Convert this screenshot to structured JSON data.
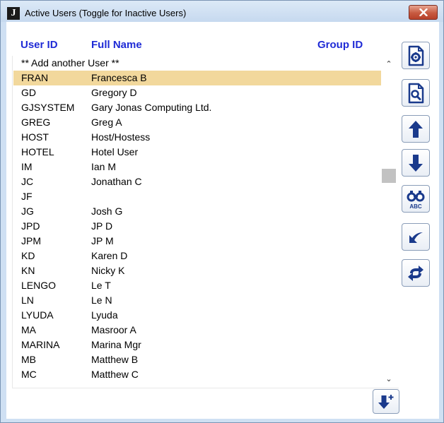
{
  "window": {
    "title": "Active Users (Toggle for Inactive Users)"
  },
  "columns": {
    "user_id": "User ID",
    "full_name": "Full Name",
    "group_id": "Group ID"
  },
  "add_row": "** Add another User **",
  "rows": [
    {
      "uid": "FRAN",
      "name": "Francesca B"
    },
    {
      "uid": "GD",
      "name": "Gregory D"
    },
    {
      "uid": "GJSYSTEM",
      "name": "Gary Jonas Computing Ltd."
    },
    {
      "uid": "GREG",
      "name": "Greg A"
    },
    {
      "uid": "HOST",
      "name": "Host/Hostess"
    },
    {
      "uid": "HOTEL",
      "name": "Hotel User"
    },
    {
      "uid": "IM",
      "name": "Ian M"
    },
    {
      "uid": "JC",
      "name": "Jonathan C"
    },
    {
      "uid": "JF",
      "name": ""
    },
    {
      "uid": "JG",
      "name": "Josh G"
    },
    {
      "uid": "JPD",
      "name": "JP D"
    },
    {
      "uid": "JPM",
      "name": "JP M"
    },
    {
      "uid": "KD",
      "name": "Karen D"
    },
    {
      "uid": "KN",
      "name": "Nicky K"
    },
    {
      "uid": "LENGO",
      "name": "Le T"
    },
    {
      "uid": "LN",
      "name": "Le N"
    },
    {
      "uid": "LYUDA",
      "name": "Lyuda"
    },
    {
      "uid": "MA",
      "name": "Masroor A"
    },
    {
      "uid": "MARINA",
      "name": "Marina Mgr"
    },
    {
      "uid": "MB",
      "name": "Matthew B"
    },
    {
      "uid": "MC",
      "name": "Matthew C"
    }
  ],
  "selected_uid": "FRAN",
  "toolbar": [
    {
      "name": "settings-doc-button",
      "icon": "gear-document-icon"
    },
    {
      "name": "search-doc-button",
      "icon": "magnify-document-icon"
    },
    {
      "name": "move-up-button",
      "icon": "arrow-up-icon"
    },
    {
      "name": "move-down-button",
      "icon": "arrow-down-icon"
    },
    {
      "name": "find-button",
      "icon": "binoculars-abc-icon"
    },
    {
      "name": "undo-button",
      "icon": "undo-arrow-icon"
    },
    {
      "name": "toggle-button",
      "icon": "refresh-arrows-icon"
    }
  ],
  "footer_button_icon": "arrow-down-add-icon",
  "binoculars_label": "ABC",
  "colors": {
    "header": "#1f2bd6",
    "selection": "#f2d89c",
    "icon": "#1a3a8c",
    "title_bar": "#c6d9ef",
    "close": "#c75a40"
  }
}
